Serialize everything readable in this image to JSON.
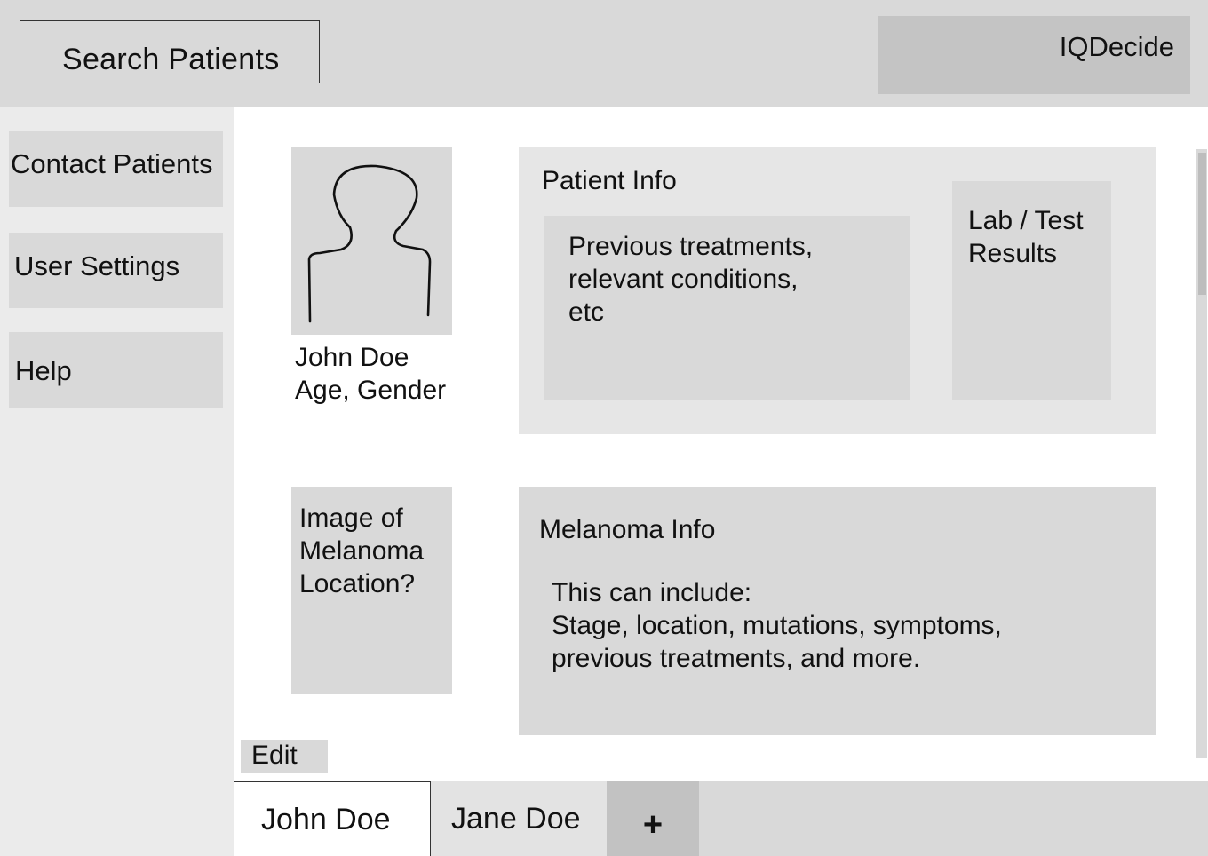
{
  "header": {
    "search_label": "Search Patients",
    "brand": "IQDecide"
  },
  "sidebar": {
    "items": [
      {
        "label": "Contact Patients"
      },
      {
        "label": "User Settings"
      },
      {
        "label": "Help"
      }
    ]
  },
  "patient": {
    "avatar_icon": "person-silhouette-icon",
    "name": "John Doe",
    "meta": "Age, Gender"
  },
  "patient_info": {
    "title": "Patient Info",
    "details": [
      "Previous treatments,",
      "relevant conditions,",
      "etc"
    ],
    "lab_results": [
      "Lab / Test",
      "Results"
    ]
  },
  "melanoma": {
    "image_placeholder": [
      "Image of",
      "Melanoma",
      "Location?"
    ],
    "title": "Melanoma Info",
    "description": [
      "This can include:",
      "Stage, location, mutations, symptoms,",
      "previous treatments, and more."
    ]
  },
  "edit_label": "Edit",
  "tabs": [
    {
      "label": "John Doe",
      "active": true
    },
    {
      "label": "Jane Doe",
      "active": false
    }
  ],
  "add_tab_label": "+",
  "colors": {
    "panel": "#d9d9d9",
    "panel_light": "#e6e6e6",
    "sidebar_bg": "#ebebeb",
    "accent_dark": "#c4c4c4"
  }
}
